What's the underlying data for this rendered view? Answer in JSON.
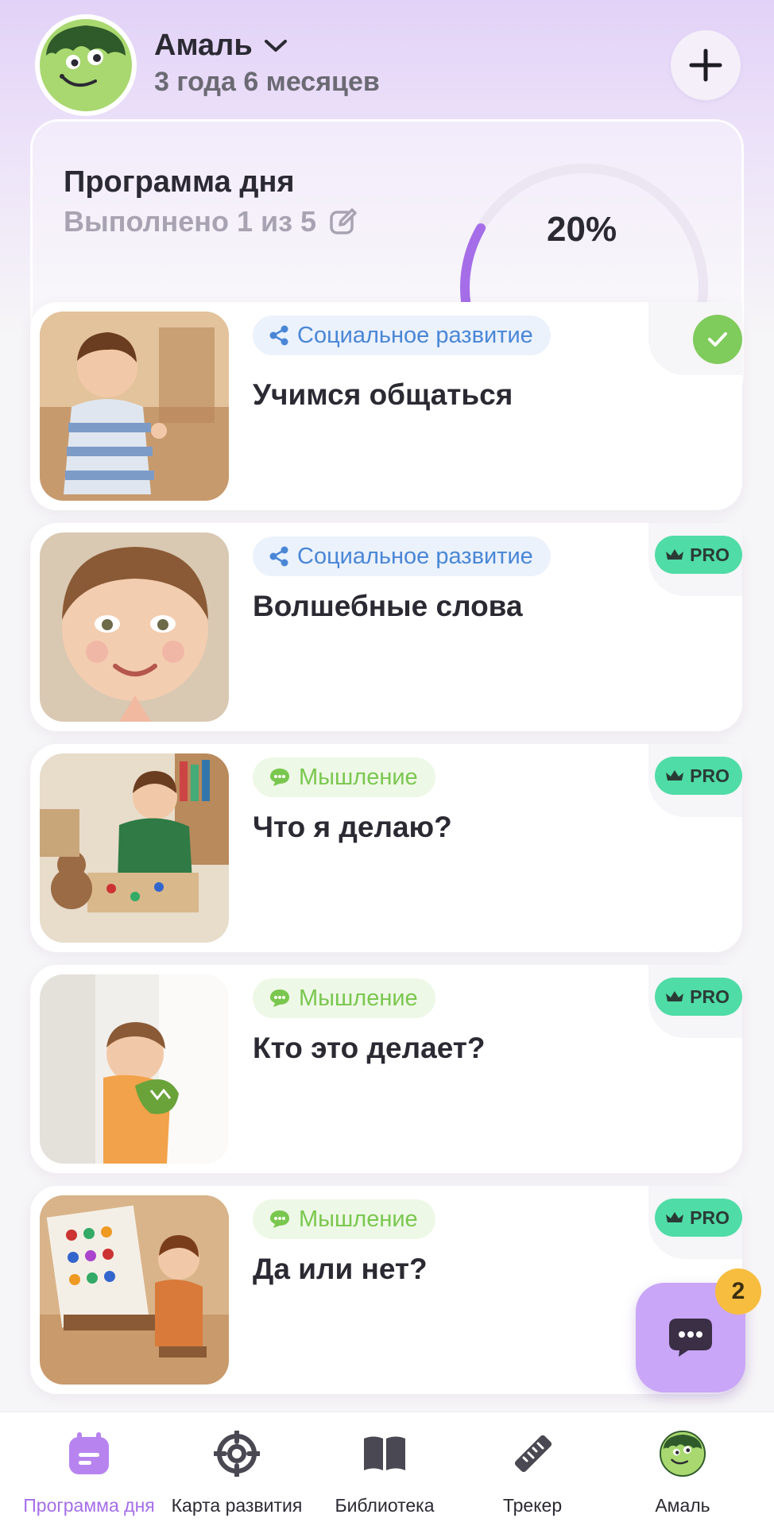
{
  "header": {
    "child_name": "Амаль",
    "child_age": "3 года 6 месяцев"
  },
  "program": {
    "title": "Программа дня",
    "completed_text": "Выполнено 1 из 5",
    "progress_text": "20%",
    "progress_value": 0.2
  },
  "activities": [
    {
      "tag": "Социальное развитие",
      "tag_type": "social",
      "title": "Учимся общаться",
      "status": "done"
    },
    {
      "tag": "Социальное развитие",
      "tag_type": "social",
      "title": "Волшебные слова",
      "status": "pro",
      "pro_label": "PRO"
    },
    {
      "tag": "Мышление",
      "tag_type": "think",
      "title": "Что я делаю?",
      "status": "pro",
      "pro_label": "PRO"
    },
    {
      "tag": "Мышление",
      "tag_type": "think",
      "title": "Кто это делает?",
      "status": "pro",
      "pro_label": "PRO"
    },
    {
      "tag": "Мышление",
      "tag_type": "think",
      "title": "Да или нет?",
      "status": "pro",
      "pro_label": "PRO"
    }
  ],
  "chat": {
    "badge_count": "2"
  },
  "nav": [
    {
      "label": "Программа дня",
      "icon": "calendar-icon",
      "active": true
    },
    {
      "label": "Карта развития",
      "icon": "target-icon",
      "active": false
    },
    {
      "label": "Библиотека",
      "icon": "book-icon",
      "active": false
    },
    {
      "label": "Трекер",
      "icon": "ruler-icon",
      "active": false
    },
    {
      "label": "Амаль",
      "icon": "profile-avatar-icon",
      "active": false
    }
  ],
  "colors": {
    "accent": "#a56ee8",
    "pro": "#4fdca6",
    "done": "#7fcb5b",
    "social_tag": "#4a86d6",
    "think_tag": "#7ac74f",
    "badge": "#f7bd3f"
  }
}
